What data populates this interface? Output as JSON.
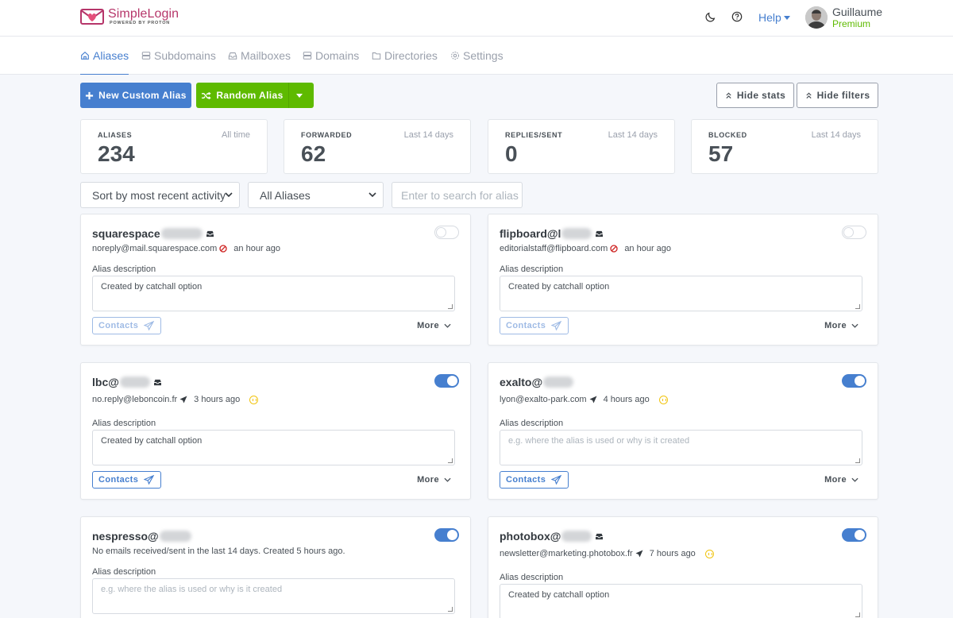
{
  "header": {
    "logo_name": "SimpleLogin",
    "logo_sub": "POWERED BY PROTON",
    "help_label": "Help",
    "user_name": "Guillaume",
    "user_plan": "Premium"
  },
  "nav": {
    "items": [
      {
        "label": "Aliases",
        "icon": "home-icon"
      },
      {
        "label": "Subdomains",
        "icon": "server-icon"
      },
      {
        "label": "Mailboxes",
        "icon": "inbox-icon"
      },
      {
        "label": "Domains",
        "icon": "server-icon"
      },
      {
        "label": "Directories",
        "icon": "folder-icon"
      },
      {
        "label": "Settings",
        "icon": "gear-icon"
      }
    ]
  },
  "actions": {
    "new_custom_alias": "New Custom Alias",
    "random_alias": "Random Alias",
    "hide_stats": "Hide stats",
    "hide_filters": "Hide filters"
  },
  "stats": [
    {
      "label": "ALIASES",
      "period": "All time",
      "value": "234"
    },
    {
      "label": "FORWARDED",
      "period": "Last 14 days",
      "value": "62"
    },
    {
      "label": "REPLIES/SENT",
      "period": "Last 14 days",
      "value": "0"
    },
    {
      "label": "BLOCKED",
      "period": "Last 14 days",
      "value": "57"
    }
  ],
  "filters": {
    "sort_value": "Sort by most recent activity",
    "type_value": "All Aliases",
    "search_placeholder": "Enter to search for alias"
  },
  "card_common": {
    "desc_label": "Alias description",
    "contacts_label": "Contacts",
    "more_label": "More",
    "desc_placeholder": "e.g. where the alias is used or why is it created"
  },
  "aliases": [
    {
      "name": "squarespace",
      "contact": "noreply@mail.squarespace.com",
      "time": "an hour ago",
      "description": "Created by catchall option",
      "enabled": false
    },
    {
      "name": "flipboard@l",
      "contact": "editorialstaff@flipboard.com",
      "time": "an hour ago",
      "description": "Created by catchall option",
      "enabled": false
    },
    {
      "name": "lbc@",
      "contact": "no.reply@leboncoin.fr",
      "time": "3 hours ago",
      "description": "Created by catchall option",
      "enabled": true
    },
    {
      "name": "exalto@",
      "contact": "lyon@exalto-park.com",
      "time": "4 hours ago",
      "description": "",
      "enabled": true
    },
    {
      "name": "nespresso@",
      "status": "No emails received/sent in the last 14 days. Created 5 hours ago.",
      "description": "",
      "enabled": true
    },
    {
      "name": "photobox@",
      "contact": "newsletter@marketing.photobox.fr",
      "time": "7 hours ago",
      "description": "Created by catchall option",
      "enabled": true
    }
  ]
}
